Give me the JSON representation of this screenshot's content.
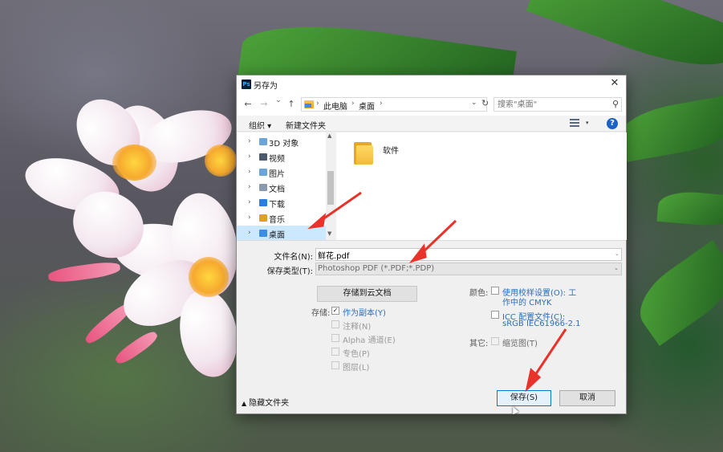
{
  "dialog": {
    "title": "另存为",
    "app_icon_text": "Ps",
    "close_glyph": "✕"
  },
  "nav": {
    "back": "←",
    "forward": "→",
    "recent": "⌄",
    "up": "↑",
    "breadcrumb": [
      "此电脑",
      "桌面"
    ],
    "refresh": "↻",
    "search_placeholder": "搜索\"桌面\""
  },
  "toolbar": {
    "organize_label": "组织 ▾",
    "new_folder_label": "新建文件夹",
    "help_label": "?"
  },
  "tree": {
    "items": [
      {
        "label": "3D 对象",
        "icon": "3d-objects-icon",
        "color": "#6aa4d8"
      },
      {
        "label": "视频",
        "icon": "videos-icon",
        "color": "#4a5a6c"
      },
      {
        "label": "图片",
        "icon": "pictures-icon",
        "color": "#6aa4d8"
      },
      {
        "label": "文档",
        "icon": "documents-icon",
        "color": "#8a9bb0"
      },
      {
        "label": "下载",
        "icon": "downloads-icon",
        "color": "#2a7de1"
      },
      {
        "label": "音乐",
        "icon": "music-icon",
        "color": "#e0a020"
      },
      {
        "label": "桌面",
        "icon": "desktop-icon",
        "color": "#3a8ee6",
        "selected": true
      }
    ]
  },
  "files": [
    {
      "name": "软件",
      "type": "folder"
    }
  ],
  "form": {
    "filename_label": "文件名(N):",
    "filename_value": "鲜花.pdf",
    "filetype_label": "保存类型(T):",
    "filetype_value": "Photoshop PDF (*.PDF;*.PDP)"
  },
  "options": {
    "cloud_button": "存储到云文档",
    "save_label": "存储:",
    "save_options": [
      {
        "label": "作为副本(Y)",
        "checked": true,
        "enabled": true
      },
      {
        "label": "注释(N)",
        "checked": false,
        "enabled": false
      },
      {
        "label": "Alpha 通道(E)",
        "checked": false,
        "enabled": false
      },
      {
        "label": "专色(P)",
        "checked": false,
        "enabled": false
      },
      {
        "label": "图层(L)",
        "checked": false,
        "enabled": false
      }
    ],
    "color_label": "颜色:",
    "proof_setup_line1": "使用校样设置(O): 工",
    "proof_setup_line2": "作中的 CMYK",
    "icc_line1": "ICC 配置文件(C):",
    "icc_line2": "sRGB IEC61966-2.1",
    "other_label": "其它:",
    "thumbnail_label": "缩览图(T)"
  },
  "footer": {
    "hide_folders": "隐藏文件夹",
    "save_button": "保存(S)",
    "cancel_button": "取消"
  },
  "colors": {
    "annotation_arrow": "#e8332a",
    "selection": "#cce8ff",
    "link_blue": "#2a6ebc",
    "primary_button_border": "#0078d7"
  }
}
